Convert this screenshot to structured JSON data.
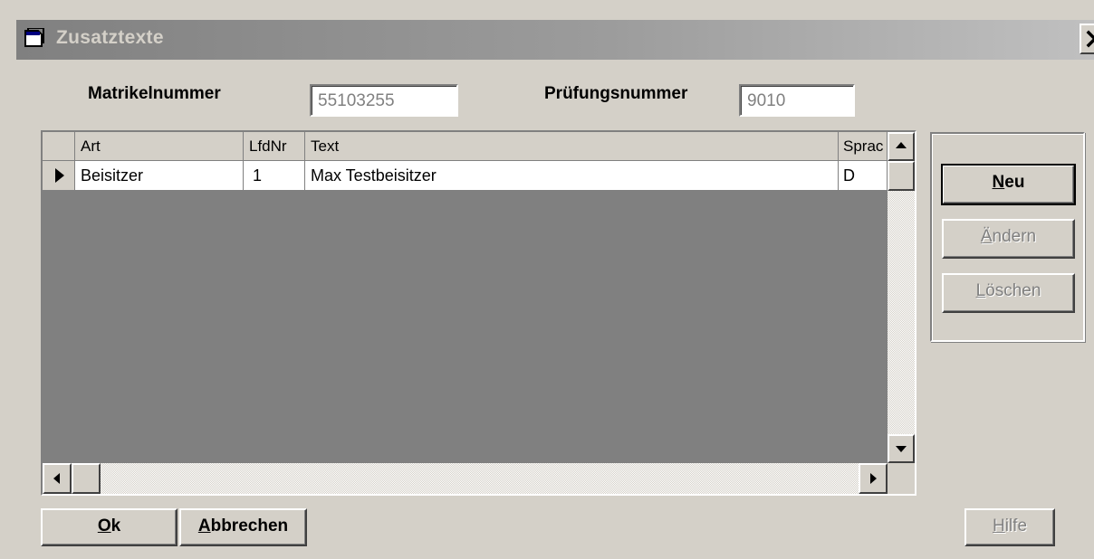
{
  "window": {
    "title": "Zusatztexte"
  },
  "form": {
    "matrikel_label": "Matrikelnummer",
    "matrikel_value": "55103255",
    "pruefung_label": "Prüfungsnummer",
    "pruefung_value": "9010"
  },
  "grid": {
    "columns": [
      "Art",
      "LfdNr",
      "Text",
      "Sprache"
    ],
    "columns_visible": [
      "Art",
      "LfdNr",
      "Text",
      "Sprac"
    ],
    "rows": [
      {
        "art": "Beisitzer",
        "lfdnr": "1",
        "text": "Max Testbeisitzer",
        "sprache": "D"
      }
    ]
  },
  "buttons": {
    "neu_key": "N",
    "neu_rest": "eu",
    "aendern_key": "Ä",
    "aendern_rest": "ndern",
    "loeschen_key": "L",
    "loeschen_rest": "öschen",
    "ok_key": "O",
    "ok_rest": "k",
    "abbrechen_key": "A",
    "abbrechen_rest": "bbrechen",
    "hilfe_key": "H",
    "hilfe_rest": "ilfe"
  },
  "icons": {
    "window": "document-window-icon",
    "close": "close-x-icon",
    "row_indicator": "triangle-right-icon"
  },
  "colors": {
    "face": "#d4d0c8",
    "grid_background": "#808080",
    "titlebar_inactive": "#808080",
    "disabled_text": "#808080"
  }
}
